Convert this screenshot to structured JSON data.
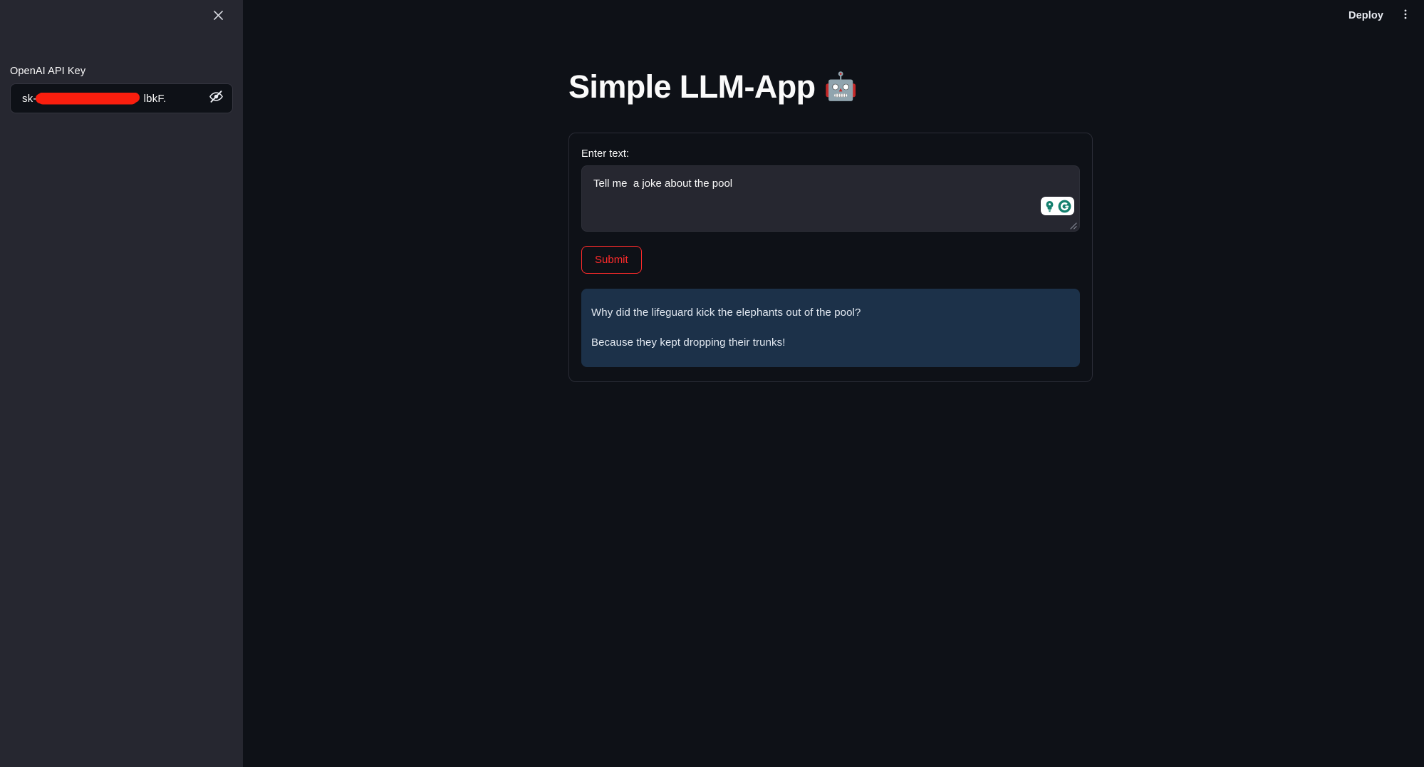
{
  "app": {
    "background_color": "#0e1117",
    "sidebar_color": "#262730",
    "accent_color": "#ff2b2b",
    "info_box_color": "#1c3149"
  },
  "toolbar": {
    "deploy_label": "Deploy",
    "main_menu_icon": "three-dots-vertical-icon"
  },
  "sidebar": {
    "close_icon": "close-icon",
    "api_key": {
      "label": "OpenAI API Key",
      "value_prefix": "sk-",
      "value_suffix": "lbkF.",
      "redacted": true,
      "visibility_icon": "eye-slash-icon"
    }
  },
  "main": {
    "title": "Simple LLM-App",
    "title_emoji": "🤖",
    "form": {
      "input_label": "Enter text:",
      "textarea_value": "Tell me  a joke about the pool",
      "textarea_placeholder": "",
      "grammarly_icons": [
        "lightbulb-icon",
        "grammarly-g-icon"
      ],
      "resize_handle_icon": "resize-handle-icon",
      "submit_label": "Submit"
    },
    "result": {
      "lines": [
        "Why did the lifeguard kick the elephants out of the pool?",
        "Because they kept dropping their trunks!"
      ]
    }
  }
}
